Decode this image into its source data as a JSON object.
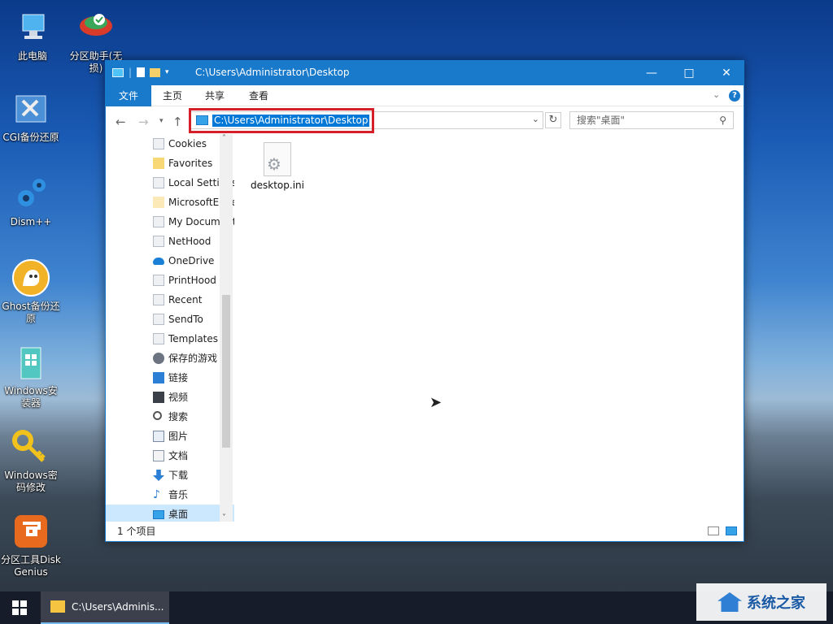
{
  "desktop": {
    "icons": [
      {
        "label": "此电脑",
        "icon": "computer-icon"
      },
      {
        "label": "分区助手(无损)",
        "icon": "partition-assistant-icon"
      },
      {
        "label": "CGI备份还原",
        "icon": "cgi-backup-icon"
      },
      {
        "label": "Dism++",
        "icon": "dism-gear-icon"
      },
      {
        "label": "Ghost备份还原",
        "icon": "ghost-icon"
      },
      {
        "label": "Windows安装器",
        "icon": "windows-installer-icon"
      },
      {
        "label": "Windows密码修改",
        "icon": "key-icon"
      },
      {
        "label": "分区工具DiskGenius",
        "icon": "diskgenius-icon"
      }
    ]
  },
  "window": {
    "title": "C:\\Users\\Administrator\\Desktop",
    "tabs": [
      "文件",
      "主页",
      "共享",
      "查看"
    ],
    "address": "C:\\Users\\Administrator\\Desktop",
    "search_placeholder": "搜索\"桌面\"",
    "accent": "#1979ca",
    "highlight_color": "#d5202a"
  },
  "nav_pane": {
    "items": [
      {
        "label": "Cookies",
        "icon": "folder-plain-icon"
      },
      {
        "label": "Favorites",
        "icon": "folder-icon"
      },
      {
        "label": "Local Settings",
        "icon": "folder-plain-icon"
      },
      {
        "label": "MicrosoftEdge",
        "icon": "folder-icon"
      },
      {
        "label": "My Documents",
        "icon": "folder-plain-icon"
      },
      {
        "label": "NetHood",
        "icon": "folder-plain-icon"
      },
      {
        "label": "OneDrive",
        "icon": "onedrive-icon"
      },
      {
        "label": "PrintHood",
        "icon": "folder-plain-icon"
      },
      {
        "label": "Recent",
        "icon": "folder-plain-icon"
      },
      {
        "label": "SendTo",
        "icon": "folder-plain-icon"
      },
      {
        "label": "Templates",
        "icon": "folder-plain-icon"
      },
      {
        "label": "保存的游戏",
        "icon": "saved-games-icon"
      },
      {
        "label": "链接",
        "icon": "links-icon"
      },
      {
        "label": "视频",
        "icon": "videos-icon"
      },
      {
        "label": "搜索",
        "icon": "search-icon"
      },
      {
        "label": "图片",
        "icon": "pictures-icon"
      },
      {
        "label": "文档",
        "icon": "documents-icon"
      },
      {
        "label": "下载",
        "icon": "downloads-icon"
      },
      {
        "label": "音乐",
        "icon": "music-icon"
      },
      {
        "label": "桌面",
        "icon": "desktop-icon",
        "selected": true
      }
    ]
  },
  "content": {
    "files": [
      {
        "name": "desktop.ini",
        "icon": "settings-file-icon"
      }
    ]
  },
  "status": {
    "item_count": "1 个项目"
  },
  "taskbar": {
    "task_label": "C:\\Users\\Adminis..."
  },
  "watermark": {
    "text": "系统之家"
  }
}
